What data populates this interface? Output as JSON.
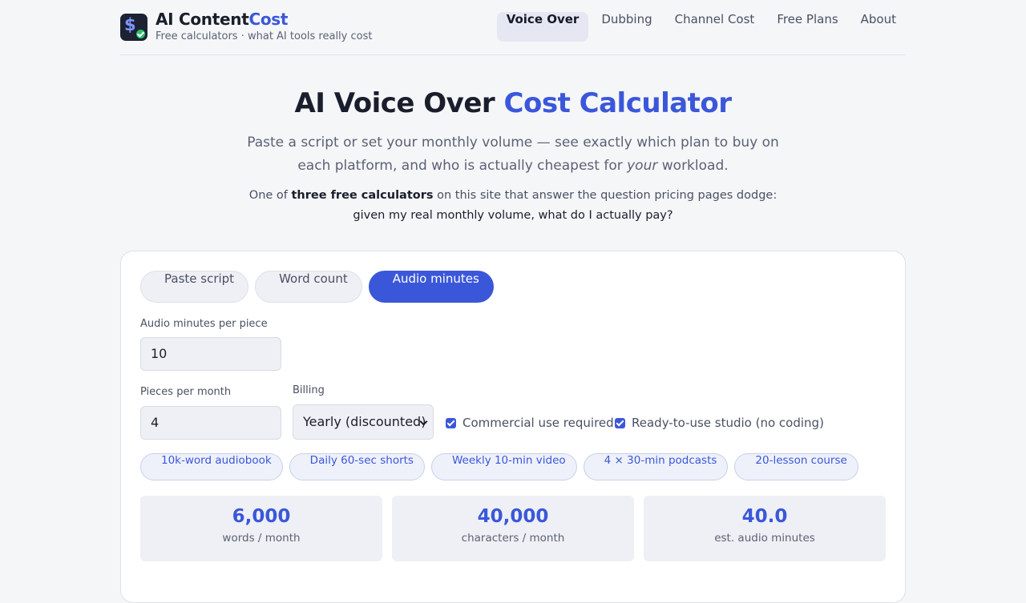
{
  "header": {
    "brand_main": "AI Content",
    "brand_accent": "Cost",
    "tagline": "Free calculators · what AI tools really cost",
    "logo_icon": "dollar-check-logo",
    "nav": [
      {
        "label": "Voice Over",
        "active": true
      },
      {
        "label": "Dubbing",
        "active": false
      },
      {
        "label": "Channel Cost",
        "active": false
      },
      {
        "label": "Free Plans",
        "active": false
      },
      {
        "label": "About",
        "active": false
      }
    ]
  },
  "hero": {
    "title_main": "AI Voice Over ",
    "title_accent": "Cost Calculator",
    "subtitle_before": "Paste a script or set your monthly volume — see exactly which plan to buy on each platform, and who is actually cheapest for ",
    "subtitle_em": "your",
    "subtitle_after": " workload.",
    "note_before": "One of ",
    "note_bold": "three free calculators",
    "note_after": " on this site that answer the question pricing pages dodge:",
    "note_line2": "given my real monthly volume, what do I actually pay?"
  },
  "calculator": {
    "modes": [
      {
        "label": "Paste script",
        "active": false
      },
      {
        "label": "Word count",
        "active": false
      },
      {
        "label": "Audio minutes",
        "active": true
      }
    ],
    "audio_minutes_label": "Audio minutes per piece",
    "audio_minutes_value": "10",
    "pieces_label": "Pieces per month",
    "pieces_value": "4",
    "billing_label": "Billing",
    "billing_value": "Yearly (discounted)",
    "commercial_label": "Commercial use required",
    "commercial_checked": true,
    "studio_label": "Ready-to-use studio (no coding)",
    "studio_checked": true,
    "presets": [
      "10k-word audiobook",
      "Daily 60-sec shorts",
      "Weekly 10-min video",
      "4 × 30-min podcasts",
      "20-lesson course"
    ],
    "stats": [
      {
        "value": "6,000",
        "label": "words / month"
      },
      {
        "value": "40,000",
        "label": "characters / month"
      },
      {
        "value": "40.0",
        "label": "est. audio minutes"
      }
    ]
  },
  "colors": {
    "accent": "#3b57d9",
    "background": "#f5f6f8",
    "check": "#2bbf6c"
  }
}
